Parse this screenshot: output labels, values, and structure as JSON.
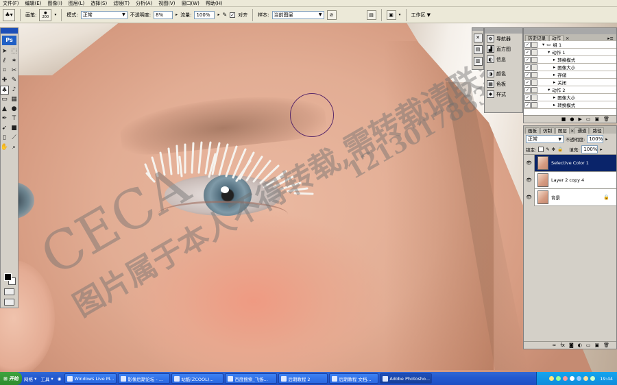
{
  "menubar": {
    "items": [
      "文件(F)",
      "编辑(E)",
      "图像(I)",
      "图层(L)",
      "选择(S)",
      "滤镜(T)",
      "分析(A)",
      "视图(V)",
      "窗口(W)",
      "帮助(H)"
    ]
  },
  "options_bar": {
    "brush_label": "画笔:",
    "brush_size": "200",
    "mode_label": "模式:",
    "mode_value": "正常",
    "opacity_label": "不透明度:",
    "opacity_value": "8%",
    "flow_label": "流量:",
    "flow_value": "100%",
    "align_label": "对齐",
    "align_checked": true,
    "sample_label": "样本:",
    "sample_value": "当前图层",
    "workspace_label": "工作区"
  },
  "toolbox": {
    "logo": "Ps",
    "tools": [
      "move-tool",
      "marquee-tool",
      "lasso-tool",
      "magic-wand-tool",
      "crop-tool",
      "slice-tool",
      "healing-brush-tool",
      "brush-tool",
      "clone-stamp-tool",
      "history-brush-tool",
      "eraser-tool",
      "gradient-tool",
      "blur-tool",
      "dodge-tool",
      "pen-tool",
      "type-tool",
      "path-selection-tool",
      "shape-tool",
      "notes-tool",
      "eyedropper-tool",
      "hand-tool",
      "zoom-tool"
    ]
  },
  "dock": {
    "items": [
      {
        "label": "导航器",
        "icon": "navigator-icon"
      },
      {
        "label": "直方图",
        "icon": "histogram-icon"
      },
      {
        "label": "信息",
        "icon": "info-icon"
      },
      {
        "label": "颜色",
        "icon": "color-icon"
      },
      {
        "label": "色板",
        "icon": "swatches-icon"
      },
      {
        "label": "样式",
        "icon": "styles-icon"
      }
    ]
  },
  "history_panel": {
    "tabs": [
      "历史记录",
      "动作"
    ],
    "active_tab": 1,
    "rows": [
      {
        "label": "组 1",
        "indent": 0,
        "kind": "folder"
      },
      {
        "label": "动作 1",
        "indent": 1,
        "kind": "action"
      },
      {
        "label": "转换模式",
        "indent": 2,
        "kind": "step"
      },
      {
        "label": "图像大小",
        "indent": 2,
        "kind": "step"
      },
      {
        "label": "存储",
        "indent": 2,
        "kind": "step"
      },
      {
        "label": "关闭",
        "indent": 2,
        "kind": "step"
      },
      {
        "label": "动作 2",
        "indent": 1,
        "kind": "action"
      },
      {
        "label": "图像大小",
        "indent": 2,
        "kind": "step"
      },
      {
        "label": "转换模式",
        "indent": 2,
        "kind": "step"
      }
    ]
  },
  "layers_panel": {
    "tabs": [
      "画板",
      "仿制",
      "图层",
      "通道",
      "路径"
    ],
    "active_tab": 2,
    "blend_mode": "正常",
    "opacity_label": "不透明度:",
    "opacity_value": "100%",
    "lock_label": "锁定:",
    "fill_label": "填充:",
    "fill_value": "100%",
    "layers": [
      {
        "name": "Selective Color 1",
        "active": true,
        "locked": false
      },
      {
        "name": "Layer 2 copy 4",
        "active": false,
        "locked": false
      },
      {
        "name": "背景",
        "active": false,
        "locked": true
      }
    ]
  },
  "watermark": {
    "line1": "CECA",
    "line2": "图片属于本人不得转载,需转载请联系",
    "line3": "1213017883"
  },
  "taskbar": {
    "start": "开始",
    "quick": [
      "网络",
      "工具"
    ],
    "tasks": [
      {
        "label": "Windows Live M...",
        "active": false
      },
      {
        "label": "影像后期论坛 - ...",
        "active": false
      },
      {
        "label": "站酷(ZCOOL)...",
        "active": false
      },
      {
        "label": "百度搜索_飞扬...",
        "active": false
      },
      {
        "label": "后期教程 2",
        "active": false
      },
      {
        "label": "后期教程 文档...",
        "active": false
      },
      {
        "label": "Adobe Photosho...",
        "active": true
      }
    ],
    "clock": "19:44"
  }
}
